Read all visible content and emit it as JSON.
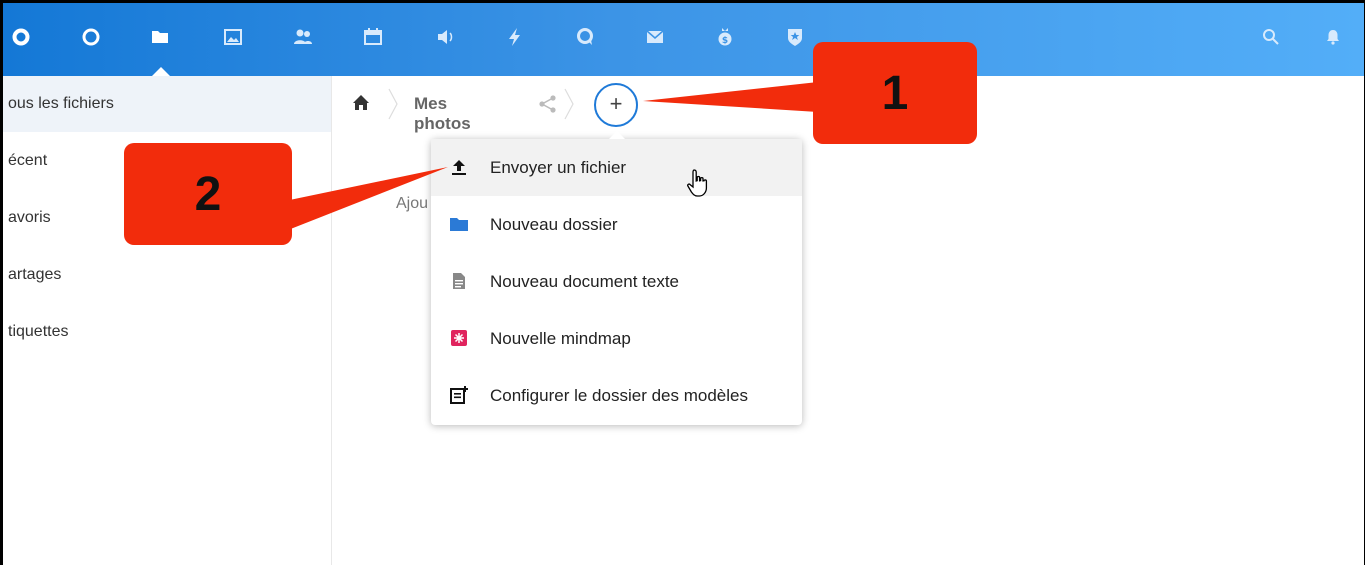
{
  "topbar": {
    "apps": [
      {
        "name": "logo-icon"
      },
      {
        "name": "circle-icon"
      },
      {
        "name": "folder-icon"
      },
      {
        "name": "gallery-icon"
      },
      {
        "name": "contacts-icon"
      },
      {
        "name": "calendar-icon"
      },
      {
        "name": "audio-icon"
      },
      {
        "name": "activity-icon"
      },
      {
        "name": "talk-icon"
      },
      {
        "name": "mail-icon"
      },
      {
        "name": "money-icon"
      },
      {
        "name": "shield-icon"
      }
    ],
    "right_icons": [
      "search-icon",
      "notifications-icon"
    ],
    "colors": {
      "start": "#1478d6",
      "end": "#53aef8"
    }
  },
  "sidebar": {
    "items": [
      {
        "label": "ous les fichiers"
      },
      {
        "label": "écent"
      },
      {
        "label": "avoris"
      },
      {
        "label": "artages"
      },
      {
        "label": "tiquettes"
      }
    ]
  },
  "breadcrumb": {
    "current": "Mes photos"
  },
  "main": {
    "empty_hint": "Ajou"
  },
  "add_button": {
    "label": "+"
  },
  "new_menu": {
    "items": [
      {
        "label": "Envoyer un fichier",
        "icon": "upload-icon"
      },
      {
        "label": "Nouveau dossier",
        "icon": "folder-icon"
      },
      {
        "label": "Nouveau document texte",
        "icon": "text-document-icon"
      },
      {
        "label": "Nouvelle mindmap",
        "icon": "mindmap-icon"
      },
      {
        "label": "Configurer le dossier des modèles",
        "icon": "template-icon"
      }
    ]
  },
  "annotations": {
    "callout_1": "1",
    "callout_2": "2",
    "color": "#f22c0c"
  }
}
